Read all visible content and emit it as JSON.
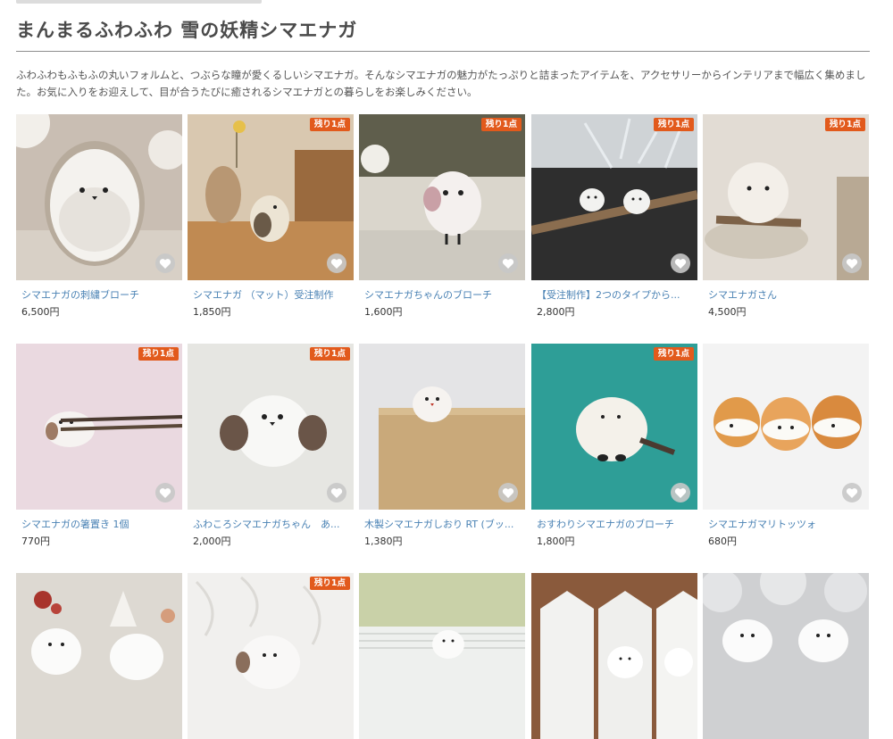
{
  "page": {
    "title": "まんまるふわふわ 雪の妖精シマエナガ",
    "description": "ふわふわもふもふの丸いフォルムと、つぶらな瞳が愛くるしいシマエナガ。そんなシマエナガの魅力がたっぷりと詰まったアイテムを、アクセサリーからインテリアまで幅広く集めました。お気に入りをお迎えして、目が合うたびに癒されるシマエナガとの暮らしをお楽しみください。"
  },
  "badge_label": "残り1点",
  "colors": {
    "badge": "#e25a1c",
    "link": "#4a82b4",
    "title": "#4a4a4a"
  },
  "items": [
    {
      "name": "シマエナガの刺繍ブローチ",
      "price": "6,500円",
      "badge": false,
      "icon": "embroidered-bird-brooch-image"
    },
    {
      "name": "シマエナガ （マット）受注制作",
      "price": "1,850円",
      "badge": true,
      "icon": "ceramic-bird-figurine-image"
    },
    {
      "name": "シマエナガちゃんのブローチ",
      "price": "1,600円",
      "badge": true,
      "icon": "bird-brooch-image"
    },
    {
      "name": "【受注制作】2つのタイプから...",
      "price": "2,800円",
      "badge": true,
      "icon": "birds-on-branch-image"
    },
    {
      "name": "シマエナガさん",
      "price": "4,500円",
      "badge": true,
      "icon": "fluffy-bird-on-nest-image"
    },
    {
      "name": "シマエナガの箸置き 1個",
      "price": "770円",
      "badge": true,
      "icon": "chopstick-rest-image"
    },
    {
      "name": "ふわころシマエナガちゃん　あ...",
      "price": "2,000円",
      "badge": true,
      "icon": "fluffy-felt-bird-image"
    },
    {
      "name": "木製シマエナガしおり RT (ブッ...",
      "price": "1,380円",
      "badge": false,
      "icon": "wooden-bookmark-image"
    },
    {
      "name": "おすわりシマエナガのブローチ",
      "price": "1,800円",
      "badge": true,
      "icon": "sitting-bird-brooch-image"
    },
    {
      "name": "シマエナガマリトッツォ",
      "price": "680円",
      "badge": false,
      "icon": "maritozzo-bird-image"
    },
    {
      "name": "",
      "price": "",
      "badge": false,
      "icon": "glass-birds-image"
    },
    {
      "name": "",
      "price": "",
      "badge": true,
      "icon": "bird-on-lace-image"
    },
    {
      "name": "",
      "price": "",
      "badge": false,
      "icon": "bird-on-mask-image"
    },
    {
      "name": "",
      "price": "",
      "badge": false,
      "icon": "paper-egg-birds-image"
    },
    {
      "name": "",
      "price": "",
      "badge": false,
      "icon": "two-birds-clouds-image"
    }
  ]
}
